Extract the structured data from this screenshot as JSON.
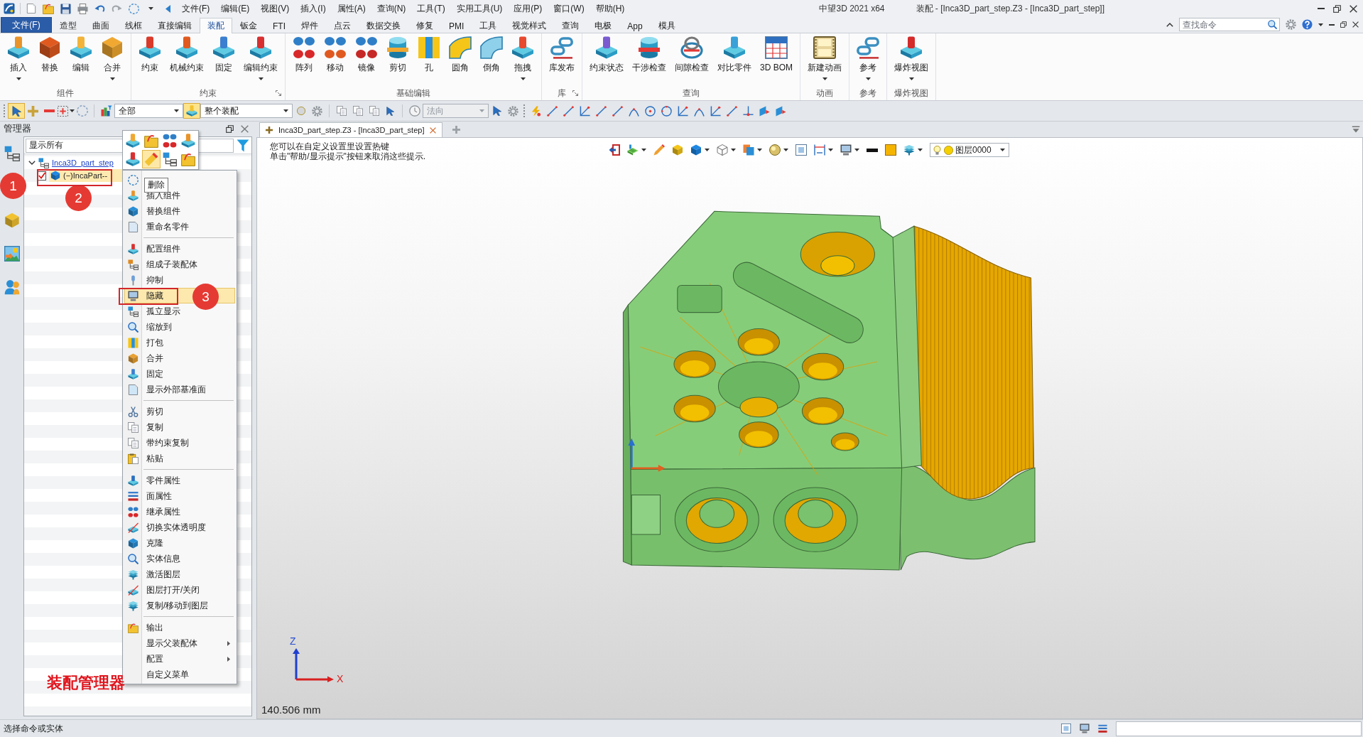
{
  "title_bar": {
    "menus": [
      "文件(F)",
      "编辑(E)",
      "视图(V)",
      "插入(I)",
      "属性(A)",
      "查询(N)",
      "工具(T)",
      "实用工具(U)",
      "应用(P)",
      "窗口(W)",
      "帮助(H)"
    ],
    "app_name": "中望3D 2021 x64",
    "document_title": "装配 - [Inca3D_part_step.Z3 - [Inca3D_part_step]]"
  },
  "ribbon": {
    "file_button": "文件(F)",
    "tabs": [
      {
        "label": "造型",
        "selected": false
      },
      {
        "label": "曲面",
        "selected": false
      },
      {
        "label": "线框",
        "selected": false
      },
      {
        "label": "直接编辑",
        "selected": false
      },
      {
        "label": "装配",
        "selected": true
      },
      {
        "label": "钣金",
        "selected": false
      },
      {
        "label": "FTI",
        "selected": false
      },
      {
        "label": "焊件",
        "selected": false
      },
      {
        "label": "点云",
        "selected": false
      },
      {
        "label": "数据交换",
        "selected": false
      },
      {
        "label": "修复",
        "selected": false
      },
      {
        "label": "PMI",
        "selected": false
      },
      {
        "label": "工具",
        "selected": false
      },
      {
        "label": "视觉样式",
        "selected": false
      },
      {
        "label": "查询",
        "selected": false
      },
      {
        "label": "电极",
        "selected": false
      },
      {
        "label": "App",
        "selected": false
      },
      {
        "label": "模具",
        "selected": false
      }
    ],
    "search": {
      "placeholder": "查找命令"
    },
    "groups": [
      {
        "label": "组件",
        "launcher": false,
        "buttons": [
          {
            "label": "插入",
            "dropdown": true
          },
          {
            "label": "替换",
            "dropdown": false
          },
          {
            "label": "编辑",
            "dropdown": false
          },
          {
            "label": "合并",
            "dropdown": true
          }
        ]
      },
      {
        "label": "约束",
        "launcher": true,
        "buttons": [
          {
            "label": "约束",
            "dropdown": false
          },
          {
            "label": "机械约束",
            "dropdown": false
          },
          {
            "label": "固定",
            "dropdown": false
          },
          {
            "label": "编辑约束",
            "dropdown": true
          }
        ]
      },
      {
        "label": "基础编辑",
        "launcher": false,
        "buttons": [
          {
            "label": "阵列",
            "dropdown": false
          },
          {
            "label": "移动",
            "dropdown": false
          },
          {
            "label": "镜像",
            "dropdown": false
          },
          {
            "label": "剪切",
            "dropdown": false
          },
          {
            "label": "孔",
            "dropdown": false
          },
          {
            "label": "圆角",
            "dropdown": false
          },
          {
            "label": "倒角",
            "dropdown": false
          },
          {
            "label": "拖拽",
            "dropdown": true
          }
        ]
      },
      {
        "label": "库",
        "launcher": true,
        "buttons": [
          {
            "label": "库发布",
            "dropdown": false
          }
        ]
      },
      {
        "label": "查询",
        "launcher": false,
        "buttons": [
          {
            "label": "约束状态",
            "dropdown": false
          },
          {
            "label": "干涉检查",
            "dropdown": false
          },
          {
            "label": "间隙检查",
            "dropdown": false
          },
          {
            "label": "对比零件",
            "dropdown": false
          },
          {
            "label": "3D BOM",
            "dropdown": false
          }
        ]
      },
      {
        "label": "动画",
        "launcher": false,
        "buttons": [
          {
            "label": "新建动画",
            "dropdown": true
          }
        ]
      },
      {
        "label": "参考",
        "launcher": false,
        "buttons": [
          {
            "label": "参考",
            "dropdown": true
          }
        ]
      },
      {
        "label": "爆炸视图",
        "launcher": false,
        "buttons": [
          {
            "label": "爆炸视图",
            "dropdown": true
          }
        ]
      }
    ]
  },
  "toolbar": {
    "select_button": {
      "on": true
    },
    "filter": "全部",
    "scope_button": {
      "on": true
    },
    "scope": "整个装配",
    "direction": {
      "value": "法向",
      "disabled": true
    }
  },
  "manager": {
    "title": "管理器",
    "filter": "显示所有",
    "tree": [
      {
        "label": "Inca3D_part_step",
        "expanded": true,
        "children": [
          {
            "label": "(−)IncaPart--",
            "checked": true,
            "selected": true
          }
        ]
      }
    ]
  },
  "mini_toolbar": [
    {
      "highlighted": false
    },
    {
      "highlighted": false
    },
    {
      "highlighted": false
    },
    {
      "highlighted": false
    },
    {
      "highlighted": false
    },
    {
      "highlighted": true
    },
    {
      "highlighted": false
    },
    {
      "highlighted": false
    }
  ],
  "context_menu": {
    "tooltip": "删除",
    "sections": [
      {
        "items": [
          {
            "highlighted": false,
            "submenu": false
          },
          {
            "label": "插入组件",
            "highlighted": false,
            "submenu": false
          },
          {
            "label": "替换组件",
            "highlighted": false,
            "submenu": false
          },
          {
            "label": "重命名零件",
            "highlighted": false,
            "submenu": false
          }
        ]
      },
      {
        "items": [
          {
            "label": "配置组件",
            "highlighted": false,
            "submenu": false
          },
          {
            "label": "组成子装配体",
            "highlighted": false,
            "submenu": false
          },
          {
            "label": "抑制",
            "highlighted": false,
            "submenu": false
          },
          {
            "label": "隐藏",
            "highlighted": true,
            "submenu": false
          },
          {
            "label": "孤立显示",
            "highlighted": false,
            "submenu": false
          },
          {
            "label": "缩放到",
            "highlighted": false,
            "submenu": false
          },
          {
            "label": "打包",
            "highlighted": false,
            "submenu": false
          },
          {
            "label": "合并",
            "highlighted": false,
            "submenu": false
          },
          {
            "label": "固定",
            "highlighted": false,
            "submenu": false
          },
          {
            "label": "显示外部基准面",
            "highlighted": false,
            "submenu": false
          }
        ]
      },
      {
        "items": [
          {
            "label": "剪切",
            "highlighted": false,
            "submenu": false
          },
          {
            "label": "复制",
            "highlighted": false,
            "submenu": false
          },
          {
            "label": "带约束复制",
            "highlighted": false,
            "submenu": false
          },
          {
            "label": "粘贴",
            "highlighted": false,
            "submenu": false
          }
        ]
      },
      {
        "items": [
          {
            "label": "零件属性",
            "highlighted": false,
            "submenu": false
          },
          {
            "label": "面属性",
            "highlighted": false,
            "submenu": false
          },
          {
            "label": "继承属性",
            "highlighted": false,
            "submenu": false
          },
          {
            "label": "切换实体透明度",
            "highlighted": false,
            "submenu": false
          },
          {
            "label": "克隆",
            "highlighted": false,
            "submenu": false
          },
          {
            "label": "实体信息",
            "highlighted": false,
            "submenu": false
          },
          {
            "label": "激活图层",
            "highlighted": false,
            "submenu": false
          },
          {
            "label": "图层打开/关闭",
            "highlighted": false,
            "submenu": false
          },
          {
            "label": "复制/移动到图层",
            "highlighted": false,
            "submenu": false
          }
        ]
      },
      {
        "items": [
          {
            "label": "输出",
            "highlighted": false,
            "submenu": false
          },
          {
            "label": "显示父装配体",
            "highlighted": false,
            "submenu": true
          },
          {
            "label": "配置",
            "highlighted": false,
            "submenu": true
          },
          {
            "label": "自定义菜单",
            "highlighted": false,
            "submenu": false
          }
        ]
      }
    ]
  },
  "document_tabs": [
    {
      "label": "Inca3D_part_step.Z3 - [Inca3D_part_step]",
      "selected": true
    }
  ],
  "viewport": {
    "hints": [
      "您可以在自定义设置里设置热键",
      "单击\"帮助/显示提示\"按钮来取消这些提示."
    ],
    "layer": "图层0000",
    "axes": {
      "z": "Z",
      "x": "X"
    },
    "scale": "140.506 mm"
  },
  "status_bar": {
    "message": "选择命令或实体"
  },
  "annotations": {
    "markers": [
      "1",
      "2",
      "3"
    ],
    "caption": "装配管理器"
  }
}
